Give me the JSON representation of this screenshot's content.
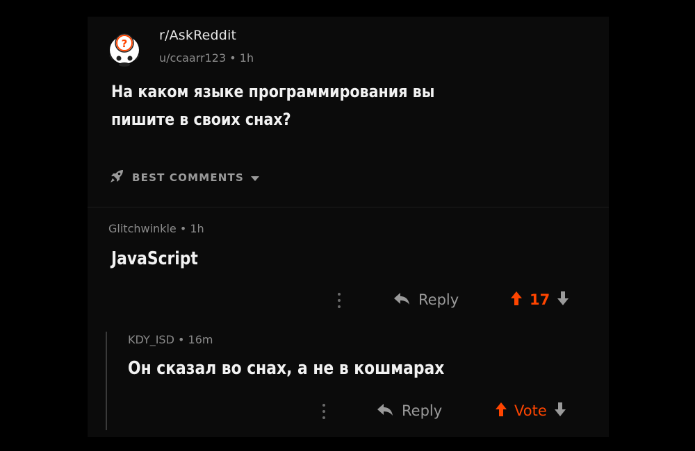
{
  "post": {
    "subreddit": "r/AskReddit",
    "author": "u/ccaarr123",
    "age": "1h",
    "title_line1": "На каком языке программирования вы",
    "title_line2": "пишите в своих снах?"
  },
  "sort": {
    "label": "BEST COMMENTS"
  },
  "comments": [
    {
      "author": "Glitchwinkle",
      "age": "1h",
      "body": "JavaScript",
      "reply_label": "Reply",
      "votes": "17"
    },
    {
      "author": "KDY_ISD",
      "age": "16m",
      "body": "Он сказал во снах, а не в кошмарах",
      "reply_label": "Reply",
      "votes": "Vote"
    }
  ],
  "colors": {
    "background": "#000000",
    "card": "#0b0b0b",
    "upvote": "#ff4500",
    "muted": "#9a9a9a",
    "text": "#f2f2f2"
  },
  "separator": "•"
}
